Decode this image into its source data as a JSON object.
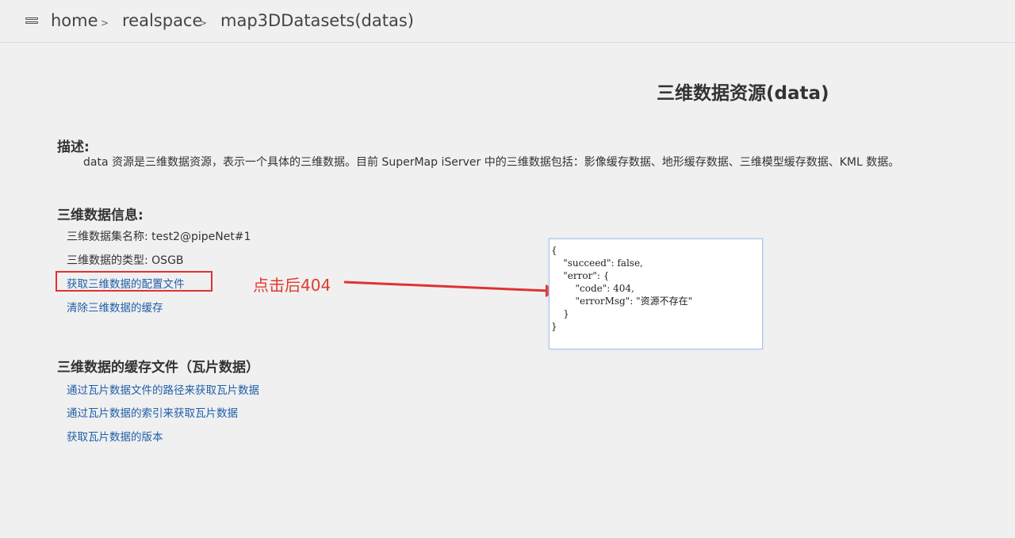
{
  "breadcrumb": {
    "items": [
      "home",
      "realspace",
      "map3DDatasets(datas)"
    ],
    "separator": ">"
  },
  "page": {
    "title": "三维数据资源(data)"
  },
  "description": {
    "heading": "描述:",
    "text": "data 资源是三维数据资源，表示一个具体的三维数据。目前 SuperMap iServer 中的三维数据包括：影像缓存数据、地形缓存数据、三维模型缓存数据、KML 数据。"
  },
  "info": {
    "heading": "三维数据信息:",
    "dataset_name_line": "三维数据集名称:  test2@pipeNet#1",
    "type_line": "三维数据的类型:  OSGB",
    "link_config": "获取三维数据的配置文件",
    "link_clear_cache": "清除三维数据的缓存"
  },
  "cache": {
    "heading": "三维数据的缓存文件（瓦片数据）",
    "link_by_path": "通过瓦片数据文件的路径来获取瓦片数据",
    "link_by_index": "通过瓦片数据的索引来获取瓦片数据",
    "link_version": "获取瓦片数据的版本"
  },
  "annotation": {
    "text": "点击后404",
    "color": "#e03a2f"
  },
  "json_response": {
    "lines": [
      "{",
      "    \"succeed\": false,",
      "    \"error\": {",
      "        \"code\": 404,",
      "        \"errorMsg\": \"资源不存在\"",
      "    }",
      "}"
    ]
  },
  "colors": {
    "link": "#1f5ea8",
    "highlight": "#e03232",
    "background": "#f0f0f0"
  }
}
